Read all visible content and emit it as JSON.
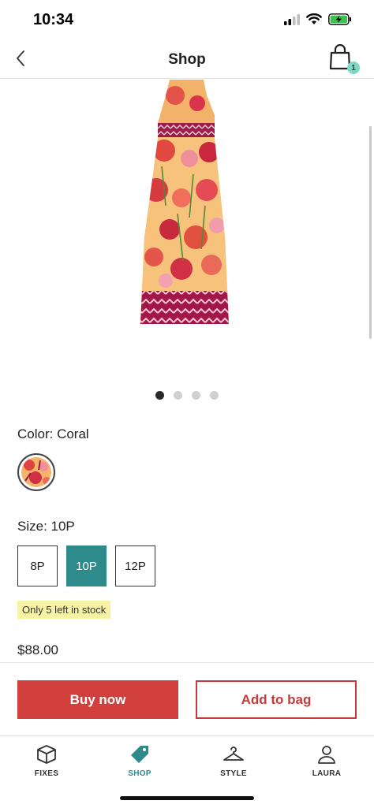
{
  "status": {
    "time": "10:34",
    "icons": [
      "signal-icon",
      "wifi-icon",
      "battery-charging-icon"
    ]
  },
  "nav": {
    "title": "Shop",
    "bag_count": "1",
    "icons": [
      "chevron-left-icon",
      "shopping-bag-icon"
    ]
  },
  "gallery": {
    "image_count": 4,
    "active_index": 0
  },
  "color": {
    "label": "Color: Coral",
    "swatch_name": "Coral"
  },
  "size": {
    "label": "Size: 10P",
    "options": [
      "8P",
      "10P",
      "12P"
    ],
    "selected": "10P"
  },
  "stock": {
    "text": "Only 5 left in stock"
  },
  "price": {
    "text": "$88.00"
  },
  "actions": {
    "buy_now": "Buy now",
    "add_to_bag": "Add to bag"
  },
  "tabs": [
    {
      "label": "FIXES",
      "icon": "box-icon"
    },
    {
      "label": "SHOP",
      "icon": "tag-icon"
    },
    {
      "label": "STYLE",
      "icon": "hanger-icon"
    },
    {
      "label": "LAURA",
      "icon": "person-icon"
    }
  ],
  "colors": {
    "accent_teal": "#2f8a8c",
    "buy_red": "#d2403e",
    "stock_yellow": "#f7f2a6",
    "badge_mint": "#7dd8c6"
  }
}
